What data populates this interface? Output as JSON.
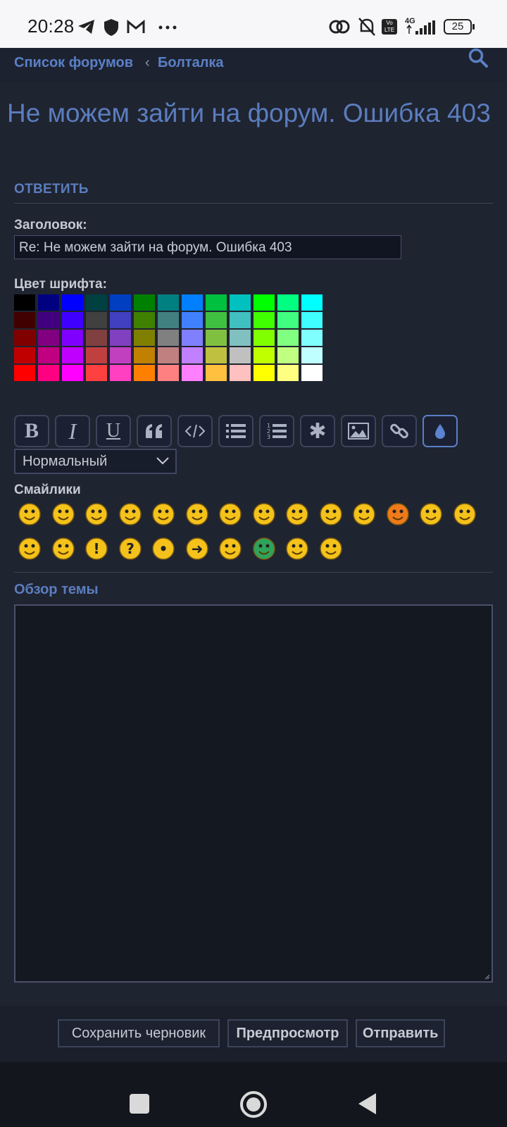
{
  "status": {
    "time": "20:28",
    "network": "4G",
    "volte": "Vo LTE",
    "battery": "25"
  },
  "nav": {
    "crumb_forums": "Список форумов",
    "crumb_sep": "‹",
    "crumb_board": "Болталка"
  },
  "topic": {
    "title": "Не можем зайти на форум. Ошибка 403"
  },
  "reply": {
    "section_title": "ОТВЕТИТЬ",
    "subject_label": "Заголовок:",
    "subject_value": "Re: Не можем зайти на форум. Ошибка 403",
    "color_label": "Цвет шрифта:",
    "font_size_selected": "Нормальный",
    "smilies_label": "Смайлики",
    "overview_label": "Обзор темы"
  },
  "palette_rows": [
    [
      "#000000",
      "#000080",
      "#0000ff",
      "#004040",
      "#0040c0",
      "#008000",
      "#008080",
      "#0080ff",
      "#00c040",
      "#00c0c0",
      "#00ff00",
      "#00ff80",
      "#00ffff"
    ],
    [
      "#400000",
      "#400080",
      "#4000ff",
      "#404040",
      "#4040c0",
      "#408000",
      "#408080",
      "#4080ff",
      "#40c040",
      "#40c0c0",
      "#40ff00",
      "#40ff80",
      "#40ffff"
    ],
    [
      "#800000",
      "#800080",
      "#8000ff",
      "#804040",
      "#8040c0",
      "#808000",
      "#808080",
      "#8080ff",
      "#80c040",
      "#80c0c0",
      "#80ff00",
      "#80ff80",
      "#80ffff"
    ],
    [
      "#c00000",
      "#c00080",
      "#c000ff",
      "#c04040",
      "#c040c0",
      "#c08000",
      "#c08080",
      "#c080ff",
      "#c0c040",
      "#c0c0c0",
      "#c0ff00",
      "#c0ff80",
      "#c0ffff"
    ],
    [
      "#ff0000",
      "#ff0080",
      "#ff00ff",
      "#ff4040",
      "#ff40c0",
      "#ff8000",
      "#ff8080",
      "#ff80ff",
      "#ffc040",
      "#ffc0c0",
      "#ffff00",
      "#ffff80",
      "#ffffff"
    ]
  ],
  "toolbar": [
    {
      "name": "bold-button",
      "glyph": "B"
    },
    {
      "name": "italic-button",
      "glyph": "I"
    },
    {
      "name": "underline-button",
      "glyph": "U"
    },
    {
      "name": "quote-button",
      "glyph": "❝"
    },
    {
      "name": "code-button",
      "glyph": "</>"
    },
    {
      "name": "list-button",
      "glyph": "list"
    },
    {
      "name": "ordered-list-button",
      "glyph": "olist"
    },
    {
      "name": "list-item-button",
      "glyph": "✱"
    },
    {
      "name": "image-button",
      "glyph": "image"
    },
    {
      "name": "link-button",
      "glyph": "link"
    },
    {
      "name": "font-color-button",
      "glyph": "drop"
    }
  ],
  "smilies": [
    "big-grin",
    "smile",
    "wink",
    "sad",
    "surprised",
    "eek",
    "confused",
    "cool",
    "laugh",
    "mad",
    "razz",
    "embarrassed",
    "crying",
    "evil",
    "twisted",
    "rolleyes",
    "exclaim",
    "question",
    "idea",
    "arrow",
    "neutral",
    "green",
    "geek",
    "uber-geek"
  ],
  "actions": {
    "save_draft": "Сохранить черновик",
    "preview": "Предпросмотр",
    "submit": "Отправить"
  },
  "colors": {
    "accent": "#5b7dbe",
    "background": "#1f2431",
    "smiley_yellow": "#f4c21a"
  }
}
